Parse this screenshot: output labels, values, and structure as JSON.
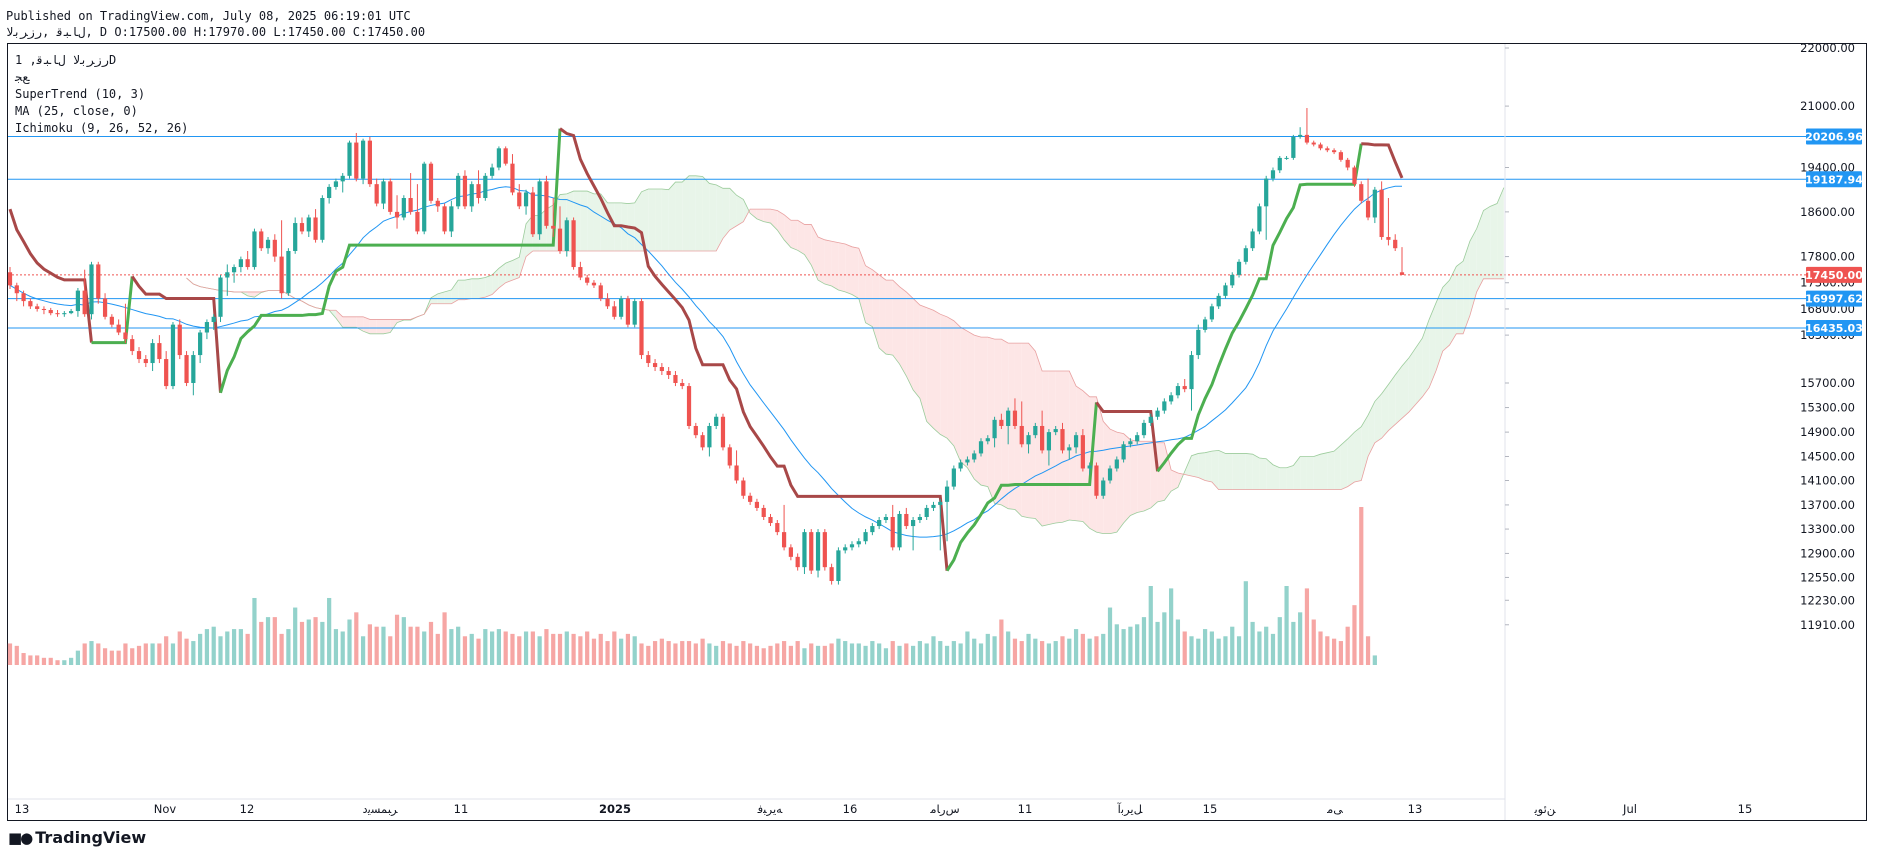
{
  "header": {
    "published": "Published on TradingView.com, July 08, 2025 06:19:01 UTC",
    "symbol_line": "ﻝﺎﺒﻗ ,ﺭﺯﺮﺑﻻ, D O:17500.00 H:17970.00 L:17450.00 C:17450.00"
  },
  "legend": {
    "symbol": "ﺭﺯﺮﺑﻻ ﻝﺎﺒﻗ, 1D",
    "exchange": "ﻊﺠ",
    "indicators": [
      "SuperTrend (10, 3)",
      "MA (25, close, 0)",
      "Ichimoku (9, 26, 52, 26)"
    ]
  },
  "footer": {
    "brand": "TradingView"
  },
  "colors": {
    "up": "#26a69a",
    "down": "#ef5350",
    "up_vol": "#93d2cb",
    "down_vol": "#f6a6a4",
    "supertrend_up": "#4caf50",
    "supertrend_down": "#a84848",
    "ma": "#2196f3",
    "cloud_bull": "#e8f5e9",
    "cloud_bear": "#fde6e6",
    "hline": "#2196f3"
  },
  "chart_data": {
    "type": "candlestick",
    "y_axis_ticks": [
      "22000.00",
      "21000.00",
      "19400.00",
      "18600.00",
      "17800.00",
      "17300.00",
      "16800.00",
      "16300.00",
      "15700.00",
      "15300.00",
      "14900.00",
      "14500.00",
      "14100.00",
      "13700.00",
      "13300.00",
      "12900.00",
      "12550.00",
      "12230.00",
      "11910.00"
    ],
    "x_axis_labels": [
      "13",
      "Nov",
      "12",
      "ﺮﺒﻤﺴﯾﺩ",
      "11",
      "2025",
      "ﻪﯾﺮﺒﻓ",
      "16",
      "ﺱﺭﺎﻣ",
      "11",
      "ﻞﯾﺮﺑﺁ",
      "15",
      "ﯽﻣ",
      "13",
      "ﻦﺋﻮﯾ",
      "Jul",
      "15"
    ],
    "price_labels": [
      {
        "value": "20206.96",
        "kind": "level"
      },
      {
        "value": "19187.94",
        "kind": "level"
      },
      {
        "value": "17450.00",
        "kind": "last"
      },
      {
        "value": "16997.62",
        "kind": "level"
      },
      {
        "value": "16435.03",
        "kind": "level"
      }
    ],
    "horizontal_levels": [
      20206.96,
      19187.94,
      16997.62,
      16435.03
    ],
    "last_close": 17450.0,
    "ohlc": [
      [
        17500,
        17600,
        17180,
        17250
      ],
      [
        17250,
        17300,
        16950,
        17100
      ],
      [
        17100,
        17150,
        16850,
        16950
      ],
      [
        16950,
        17000,
        16800,
        16850
      ],
      [
        16850,
        16900,
        16750,
        16800
      ],
      [
        16800,
        16850,
        16700,
        16780
      ],
      [
        16780,
        16820,
        16680,
        16720
      ],
      [
        16720,
        16780,
        16650,
        16700
      ],
      [
        16700,
        16760,
        16650,
        16720
      ],
      [
        16720,
        16800,
        16700,
        16760
      ],
      [
        16760,
        17200,
        16650,
        17150
      ],
      [
        17150,
        17550,
        16650,
        16700
      ],
      [
        16700,
        17700,
        16600,
        17650
      ],
      [
        17650,
        17700,
        16900,
        17000
      ],
      [
        17000,
        17100,
        16600,
        16650
      ],
      [
        16650,
        16700,
        16450,
        16500
      ],
      [
        16500,
        16600,
        16300,
        16350
      ],
      [
        16350,
        16900,
        16200,
        16250
      ],
      [
        16250,
        16300,
        16050,
        16100
      ],
      [
        16100,
        16150,
        15950,
        16000
      ],
      [
        16000,
        16050,
        15900,
        15950
      ],
      [
        15950,
        16250,
        15850,
        16200
      ],
      [
        16200,
        16300,
        15950,
        16000
      ],
      [
        16000,
        16100,
        15600,
        15650
      ],
      [
        15650,
        16550,
        15600,
        16500
      ],
      [
        16500,
        16600,
        16000,
        16050
      ],
      [
        16050,
        16100,
        15650,
        15700
      ],
      [
        15700,
        16100,
        15500,
        16050
      ],
      [
        16050,
        16400,
        15950,
        16350
      ],
      [
        16350,
        16600,
        16250,
        16550
      ],
      [
        16550,
        16700,
        16400,
        16650
      ],
      [
        16650,
        17450,
        16550,
        17400
      ],
      [
        17400,
        17650,
        17050,
        17500
      ],
      [
        17500,
        17650,
        17300,
        17600
      ],
      [
        17600,
        17800,
        17500,
        17750
      ],
      [
        17750,
        17900,
        17550,
        17600
      ],
      [
        17600,
        18300,
        17550,
        18250
      ],
      [
        18250,
        18300,
        17900,
        17950
      ],
      [
        17950,
        18150,
        17850,
        18100
      ],
      [
        18100,
        18200,
        17700,
        17800
      ],
      [
        17800,
        18450,
        17000,
        17100
      ],
      [
        17100,
        17950,
        17050,
        17900
      ],
      [
        17900,
        18500,
        17850,
        18400
      ],
      [
        18400,
        18500,
        18200,
        18250
      ],
      [
        18250,
        18550,
        18150,
        18500
      ],
      [
        18500,
        18650,
        18050,
        18100
      ],
      [
        18100,
        18900,
        18050,
        18850
      ],
      [
        18850,
        19100,
        18750,
        19050
      ],
      [
        19050,
        19200,
        19000,
        19150
      ],
      [
        19150,
        19300,
        18950,
        19250
      ],
      [
        19250,
        20100,
        19200,
        20050
      ],
      [
        20050,
        20300,
        19150,
        19200
      ],
      [
        19200,
        20150,
        19100,
        20100
      ],
      [
        20100,
        20200,
        19050,
        19100
      ],
      [
        19100,
        19200,
        18700,
        18750
      ],
      [
        18750,
        19200,
        18650,
        19150
      ],
      [
        19150,
        19200,
        18550,
        18600
      ],
      [
        18600,
        18900,
        18300,
        18500
      ],
      [
        18500,
        18900,
        18450,
        18850
      ],
      [
        18850,
        19300,
        18550,
        18600
      ],
      [
        18600,
        19100,
        18200,
        18250
      ],
      [
        18250,
        19550,
        18200,
        19500
      ],
      [
        19500,
        19550,
        18750,
        18800
      ],
      [
        18800,
        18850,
        18600,
        18700
      ],
      [
        18700,
        18750,
        18200,
        18250
      ],
      [
        18250,
        18800,
        18150,
        18700
      ],
      [
        18700,
        19300,
        18650,
        19250
      ],
      [
        19250,
        19350,
        18650,
        18700
      ],
      [
        18700,
        19150,
        18600,
        19100
      ],
      [
        19100,
        19350,
        18750,
        18850
      ],
      [
        18850,
        19300,
        18800,
        19250
      ],
      [
        19250,
        19500,
        19200,
        19400
      ],
      [
        19400,
        19950,
        19350,
        19900
      ],
      [
        19900,
        19950,
        19450,
        19500
      ],
      [
        19500,
        19750,
        18900,
        18950
      ],
      [
        18950,
        19100,
        18650,
        18700
      ],
      [
        18700,
        19000,
        18550,
        18950
      ],
      [
        18950,
        19050,
        18150,
        18200
      ],
      [
        18200,
        19200,
        18100,
        19150
      ],
      [
        19150,
        19250,
        18300,
        18350
      ],
      [
        18350,
        18850,
        18150,
        18300
      ],
      [
        18300,
        18700,
        17850,
        17900
      ],
      [
        17900,
        18500,
        17800,
        18450
      ],
      [
        18450,
        18500,
        17550,
        17600
      ],
      [
        17600,
        17700,
        17350,
        17400
      ],
      [
        17400,
        17450,
        17250,
        17300
      ],
      [
        17300,
        17350,
        17200,
        17250
      ],
      [
        17250,
        17300,
        16950,
        17000
      ],
      [
        17000,
        17100,
        16800,
        16850
      ],
      [
        16850,
        16950,
        16600,
        16650
      ],
      [
        16650,
        17050,
        16600,
        17000
      ],
      [
        17000,
        17050,
        16450,
        16500
      ],
      [
        16500,
        17000,
        16450,
        16950
      ],
      [
        16950,
        17000,
        16000,
        16050
      ],
      [
        16050,
        16100,
        15900,
        15950
      ],
      [
        15950,
        16000,
        15850,
        15900
      ],
      [
        15900,
        15950,
        15800,
        15850
      ],
      [
        15850,
        15900,
        15750,
        15800
      ],
      [
        15800,
        15850,
        15650,
        15700
      ],
      [
        15700,
        15750,
        15600,
        15650
      ],
      [
        15650,
        15700,
        14950,
        15000
      ],
      [
        15000,
        15050,
        14800,
        14850
      ],
      [
        14850,
        14900,
        14600,
        14650
      ],
      [
        14650,
        15050,
        14500,
        15000
      ],
      [
        15000,
        15200,
        14950,
        15150
      ],
      [
        15150,
        15200,
        14600,
        14650
      ],
      [
        14650,
        14700,
        14300,
        14350
      ],
      [
        14350,
        14600,
        14050,
        14100
      ],
      [
        14100,
        14150,
        13800,
        13850
      ],
      [
        13850,
        13900,
        13700,
        13750
      ],
      [
        13750,
        13800,
        13600,
        13650
      ],
      [
        13650,
        13700,
        13450,
        13500
      ],
      [
        13500,
        13550,
        13350,
        13400
      ],
      [
        13400,
        13450,
        13200,
        13250
      ],
      [
        13250,
        13700,
        12950,
        13000
      ],
      [
        13000,
        13050,
        12800,
        12850
      ],
      [
        12850,
        12900,
        12650,
        12700
      ],
      [
        12700,
        13300,
        12600,
        13250
      ],
      [
        13250,
        13300,
        12600,
        12650
      ],
      [
        12650,
        13300,
        12550,
        13250
      ],
      [
        13250,
        13300,
        12650,
        12700
      ],
      [
        12700,
        12750,
        12450,
        12500
      ],
      [
        12500,
        13000,
        12450,
        12950
      ],
      [
        12950,
        13050,
        12900,
        13000
      ],
      [
        13000,
        13100,
        12950,
        13050
      ],
      [
        13050,
        13150,
        13000,
        13100
      ],
      [
        13100,
        13300,
        13050,
        13250
      ],
      [
        13250,
        13400,
        13200,
        13350
      ],
      [
        13350,
        13500,
        13300,
        13450
      ],
      [
        13450,
        13550,
        13400,
        13500
      ],
      [
        13500,
        13700,
        12950,
        13000
      ],
      [
        13000,
        13600,
        12950,
        13550
      ],
      [
        13550,
        13650,
        13300,
        13350
      ],
      [
        13350,
        13500,
        12950,
        13450
      ],
      [
        13450,
        13550,
        13400,
        13500
      ],
      [
        13500,
        13700,
        13450,
        13650
      ],
      [
        13650,
        13750,
        13600,
        13700
      ],
      [
        13700,
        13800,
        12950,
        13750
      ],
      [
        13750,
        14100,
        13100,
        14000
      ],
      [
        14000,
        14350,
        13950,
        14300
      ],
      [
        14300,
        14450,
        14250,
        14400
      ],
      [
        14400,
        14500,
        14350,
        14450
      ],
      [
        14450,
        14600,
        14400,
        14550
      ],
      [
        14550,
        14800,
        14500,
        14750
      ],
      [
        14750,
        14850,
        14700,
        14800
      ],
      [
        14800,
        15150,
        14650,
        15100
      ],
      [
        15100,
        15200,
        14950,
        15000
      ],
      [
        15000,
        15300,
        14700,
        15250
      ],
      [
        15250,
        15450,
        14950,
        15000
      ],
      [
        15000,
        15400,
        14650,
        14700
      ],
      [
        14700,
        14900,
        14550,
        14850
      ],
      [
        14850,
        15050,
        14800,
        15000
      ],
      [
        15000,
        15250,
        14550,
        14600
      ],
      [
        14600,
        14950,
        14350,
        14900
      ],
      [
        14900,
        15000,
        14850,
        14950
      ],
      [
        14950,
        15050,
        14550,
        14600
      ],
      [
        14600,
        14700,
        14450,
        14650
      ],
      [
        14650,
        14900,
        14550,
        14850
      ],
      [
        14850,
        14950,
        14250,
        14300
      ],
      [
        14300,
        14400,
        14200,
        14350
      ],
      [
        14350,
        14400,
        13800,
        13850
      ],
      [
        13850,
        14150,
        13800,
        14100
      ],
      [
        14100,
        14350,
        14050,
        14300
      ],
      [
        14300,
        14500,
        14250,
        14450
      ],
      [
        14450,
        14750,
        14400,
        14700
      ],
      [
        14700,
        14800,
        14650,
        14750
      ],
      [
        14750,
        14900,
        14700,
        14850
      ],
      [
        14850,
        15100,
        14800,
        15050
      ],
      [
        15050,
        15200,
        15000,
        15150
      ],
      [
        15150,
        15300,
        15100,
        15250
      ],
      [
        15250,
        15450,
        15200,
        15400
      ],
      [
        15400,
        15550,
        15350,
        15500
      ],
      [
        15500,
        15700,
        15450,
        15650
      ],
      [
        15650,
        15750,
        15550,
        15600
      ],
      [
        15600,
        16100,
        15250,
        16050
      ],
      [
        16050,
        16500,
        16000,
        16400
      ],
      [
        16400,
        16650,
        16350,
        16600
      ],
      [
        16600,
        16900,
        16550,
        16850
      ],
      [
        16850,
        17100,
        16800,
        17050
      ],
      [
        17050,
        17300,
        17000,
        17250
      ],
      [
        17250,
        17500,
        17200,
        17450
      ],
      [
        17450,
        17750,
        17400,
        17700
      ],
      [
        17700,
        18000,
        17650,
        17950
      ],
      [
        17950,
        18300,
        17900,
        18250
      ],
      [
        18250,
        18750,
        18200,
        18700
      ],
      [
        18700,
        19250,
        18100,
        19200
      ],
      [
        19200,
        19400,
        19150,
        19350
      ],
      [
        19350,
        19700,
        19300,
        19650
      ],
      [
        19650,
        19700,
        19600,
        19650
      ],
      [
        19650,
        20250,
        19600,
        20200
      ],
      [
        20200,
        20450,
        20150,
        20250
      ],
      [
        20250,
        20950,
        20000,
        20050
      ],
      [
        20050,
        20100,
        19950,
        20000
      ],
      [
        20000,
        20050,
        19850,
        19900
      ],
      [
        19900,
        19950,
        19800,
        19850
      ],
      [
        19850,
        19900,
        19750,
        19800
      ],
      [
        19800,
        19850,
        19550,
        19600
      ],
      [
        19600,
        19650,
        19350,
        19400
      ],
      [
        19400,
        19450,
        19050,
        19100
      ],
      [
        19100,
        19150,
        18750,
        18800
      ],
      [
        18800,
        19200,
        18450,
        18500
      ],
      [
        18500,
        19050,
        18400,
        19000
      ],
      [
        19000,
        19150,
        18100,
        18150
      ],
      [
        18150,
        18850,
        18000,
        18100
      ],
      [
        18100,
        18200,
        17900,
        17950
      ],
      [
        17500,
        17970,
        17450,
        17450
      ]
    ],
    "volume": [
      9,
      8,
      5,
      4,
      4,
      3,
      3,
      2,
      2,
      3,
      6,
      9,
      10,
      9,
      7,
      6,
      6,
      9,
      7,
      8,
      9,
      9,
      9,
      12,
      9,
      14,
      11,
      10,
      13,
      15,
      16,
      12,
      14,
      15,
      15,
      13,
      28,
      18,
      20,
      20,
      13,
      15,
      24,
      18,
      19,
      20,
      18,
      28,
      15,
      14,
      19,
      22,
      12,
      17,
      16,
      16,
      12,
      21,
      20,
      16,
      16,
      14,
      18,
      13,
      22,
      15,
      16,
      12,
      13,
      11,
      15,
      14,
      15,
      14,
      13,
      12,
      14,
      14,
      12,
      15,
      13,
      13,
      14,
      13,
      12,
      14,
      11,
      13,
      10,
      14,
      11,
      13,
      12,
      9,
      8,
      10,
      11,
      10,
      9,
      10,
      10,
      9,
      11,
      9,
      8,
      10,
      9,
      8,
      10,
      9,
      8,
      7,
      8,
      9,
      10,
      8,
      10,
      7,
      9,
      8,
      8,
      9,
      11,
      10,
      9,
      9,
      8,
      10,
      9,
      7,
      10,
      8,
      9,
      8,
      10,
      9,
      12,
      10,
      8,
      10,
      9,
      14,
      11,
      9,
      13,
      12,
      19,
      14,
      11,
      10,
      13,
      11,
      10,
      9,
      10,
      12,
      11,
      15,
      13,
      11,
      12,
      13,
      24,
      17,
      15,
      16,
      17,
      20,
      33,
      18,
      22,
      32,
      19,
      14,
      12,
      11,
      15,
      14,
      11,
      12,
      16,
      12,
      35,
      18,
      14,
      16,
      13,
      20,
      33,
      18,
      22,
      32,
      19,
      14,
      12,
      11,
      10,
      16,
      25,
      66,
      12,
      4
    ],
    "supertrend": [
      {
        "from": 0,
        "to": 16,
        "level": 17050,
        "trend": "down"
      },
      {
        "from": 17,
        "to": 23,
        "level": 16650,
        "trend": "up"
      }
    ]
  }
}
